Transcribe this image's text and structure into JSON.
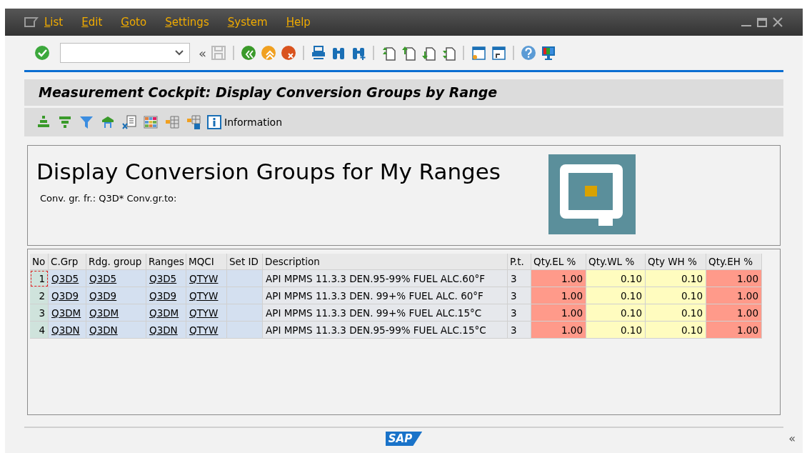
{
  "menu": [
    {
      "label": "List"
    },
    {
      "label": "Edit"
    },
    {
      "label": "Goto"
    },
    {
      "label": "Settings"
    },
    {
      "label": "System"
    },
    {
      "label": "Help"
    }
  ],
  "toolbar": {
    "back_glyph": "«"
  },
  "title": "Measurement Cockpit: Display Conversion Groups by Range",
  "alv_toolbar": {
    "info_label": "Information"
  },
  "header": {
    "heading": "Display Conversion Groups for My Ranges",
    "selection": "Conv. gr. fr.: Q3D* Conv.gr.to:"
  },
  "table": {
    "columns": [
      {
        "label": "No",
        "kind": "index"
      },
      {
        "label": "C.Grp",
        "kind": "link"
      },
      {
        "label": "Rdg. group",
        "kind": "link"
      },
      {
        "label": "Ranges",
        "kind": "link"
      },
      {
        "label": "MQCI",
        "kind": "link"
      },
      {
        "label": "Set ID",
        "kind": "key"
      },
      {
        "label": "Description",
        "kind": "text"
      },
      {
        "label": "P.t.",
        "kind": "text"
      },
      {
        "label": "Qty.EL %",
        "kind": "alert"
      },
      {
        "label": "Qty.WL %",
        "kind": "warning"
      },
      {
        "label": "Qty WH %",
        "kind": "warning"
      },
      {
        "label": "Qty.EH %",
        "kind": "alert"
      }
    ],
    "rows": [
      {
        "focused": true,
        "cells": [
          "1",
          "Q3D5",
          "Q3D5",
          "Q3D5",
          "QTYW",
          "",
          "API MPMS 11.3.3 DEN.95-99% FUEL ALC.60°F",
          "3",
          "1.00",
          "0.10",
          "0.10",
          "1.00"
        ]
      },
      {
        "focused": false,
        "cells": [
          "2",
          "Q3D9",
          "Q3D9",
          "Q3D9",
          "QTYW",
          "",
          "API MPMS 11.3.3 DEN. 99+% FUEL ALC. 60°F",
          "3",
          "1.00",
          "0.10",
          "0.10",
          "1.00"
        ]
      },
      {
        "focused": false,
        "cells": [
          "3",
          "Q3DM",
          "Q3DM",
          "Q3DM",
          "QTYW",
          "",
          "API MPMS 11.3.3 DEN. 99+% FUEL ALC.15°C",
          "3",
          "1.00",
          "0.10",
          "0.10",
          "1.00"
        ]
      },
      {
        "focused": false,
        "cells": [
          "4",
          "Q3DN",
          "Q3DN",
          "Q3DN",
          "QTYW",
          "",
          "API MPMS 11.3.3 DEN.95-99% FUEL ALC.15°C",
          "3",
          "1.00",
          "0.10",
          "0.10",
          "1.00"
        ]
      }
    ]
  },
  "footer": {
    "logo": "SAP",
    "collapse_glyph": "«"
  }
}
